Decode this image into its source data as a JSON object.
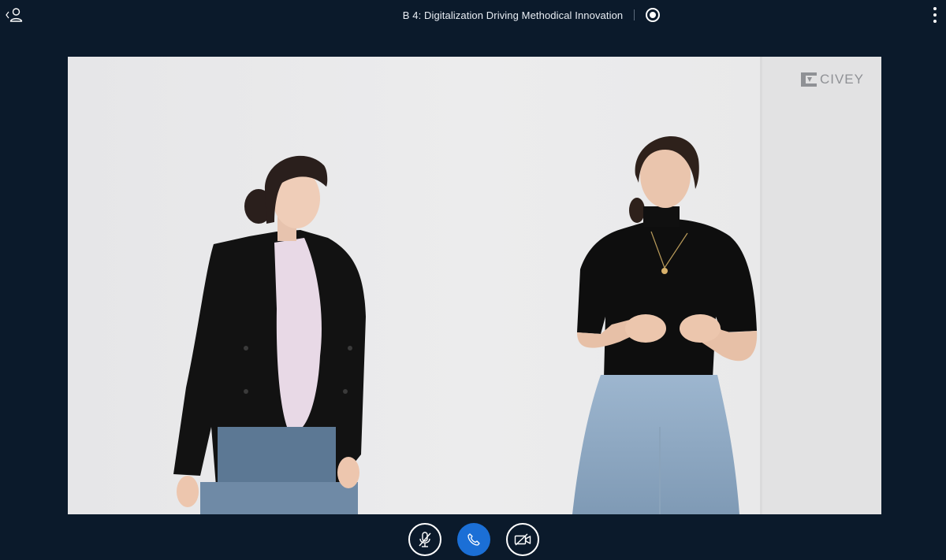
{
  "header": {
    "title": "B 4: Digitalization Driving Methodical Innovation",
    "user_list_icon": "user-list-toggle-icon",
    "record_icon": "record-icon",
    "more_icon": "more-vertical-icon"
  },
  "video": {
    "watermark_text": "CIVEY",
    "watermark_icon": "civey-logo-icon"
  },
  "controls": {
    "mic_icon": "microphone-muted-icon",
    "call_icon": "phone-icon",
    "camera_icon": "camera-off-icon"
  },
  "colors": {
    "background": "#0b1a2b",
    "accent": "#1b6fd6",
    "text": "#e9eef4"
  }
}
